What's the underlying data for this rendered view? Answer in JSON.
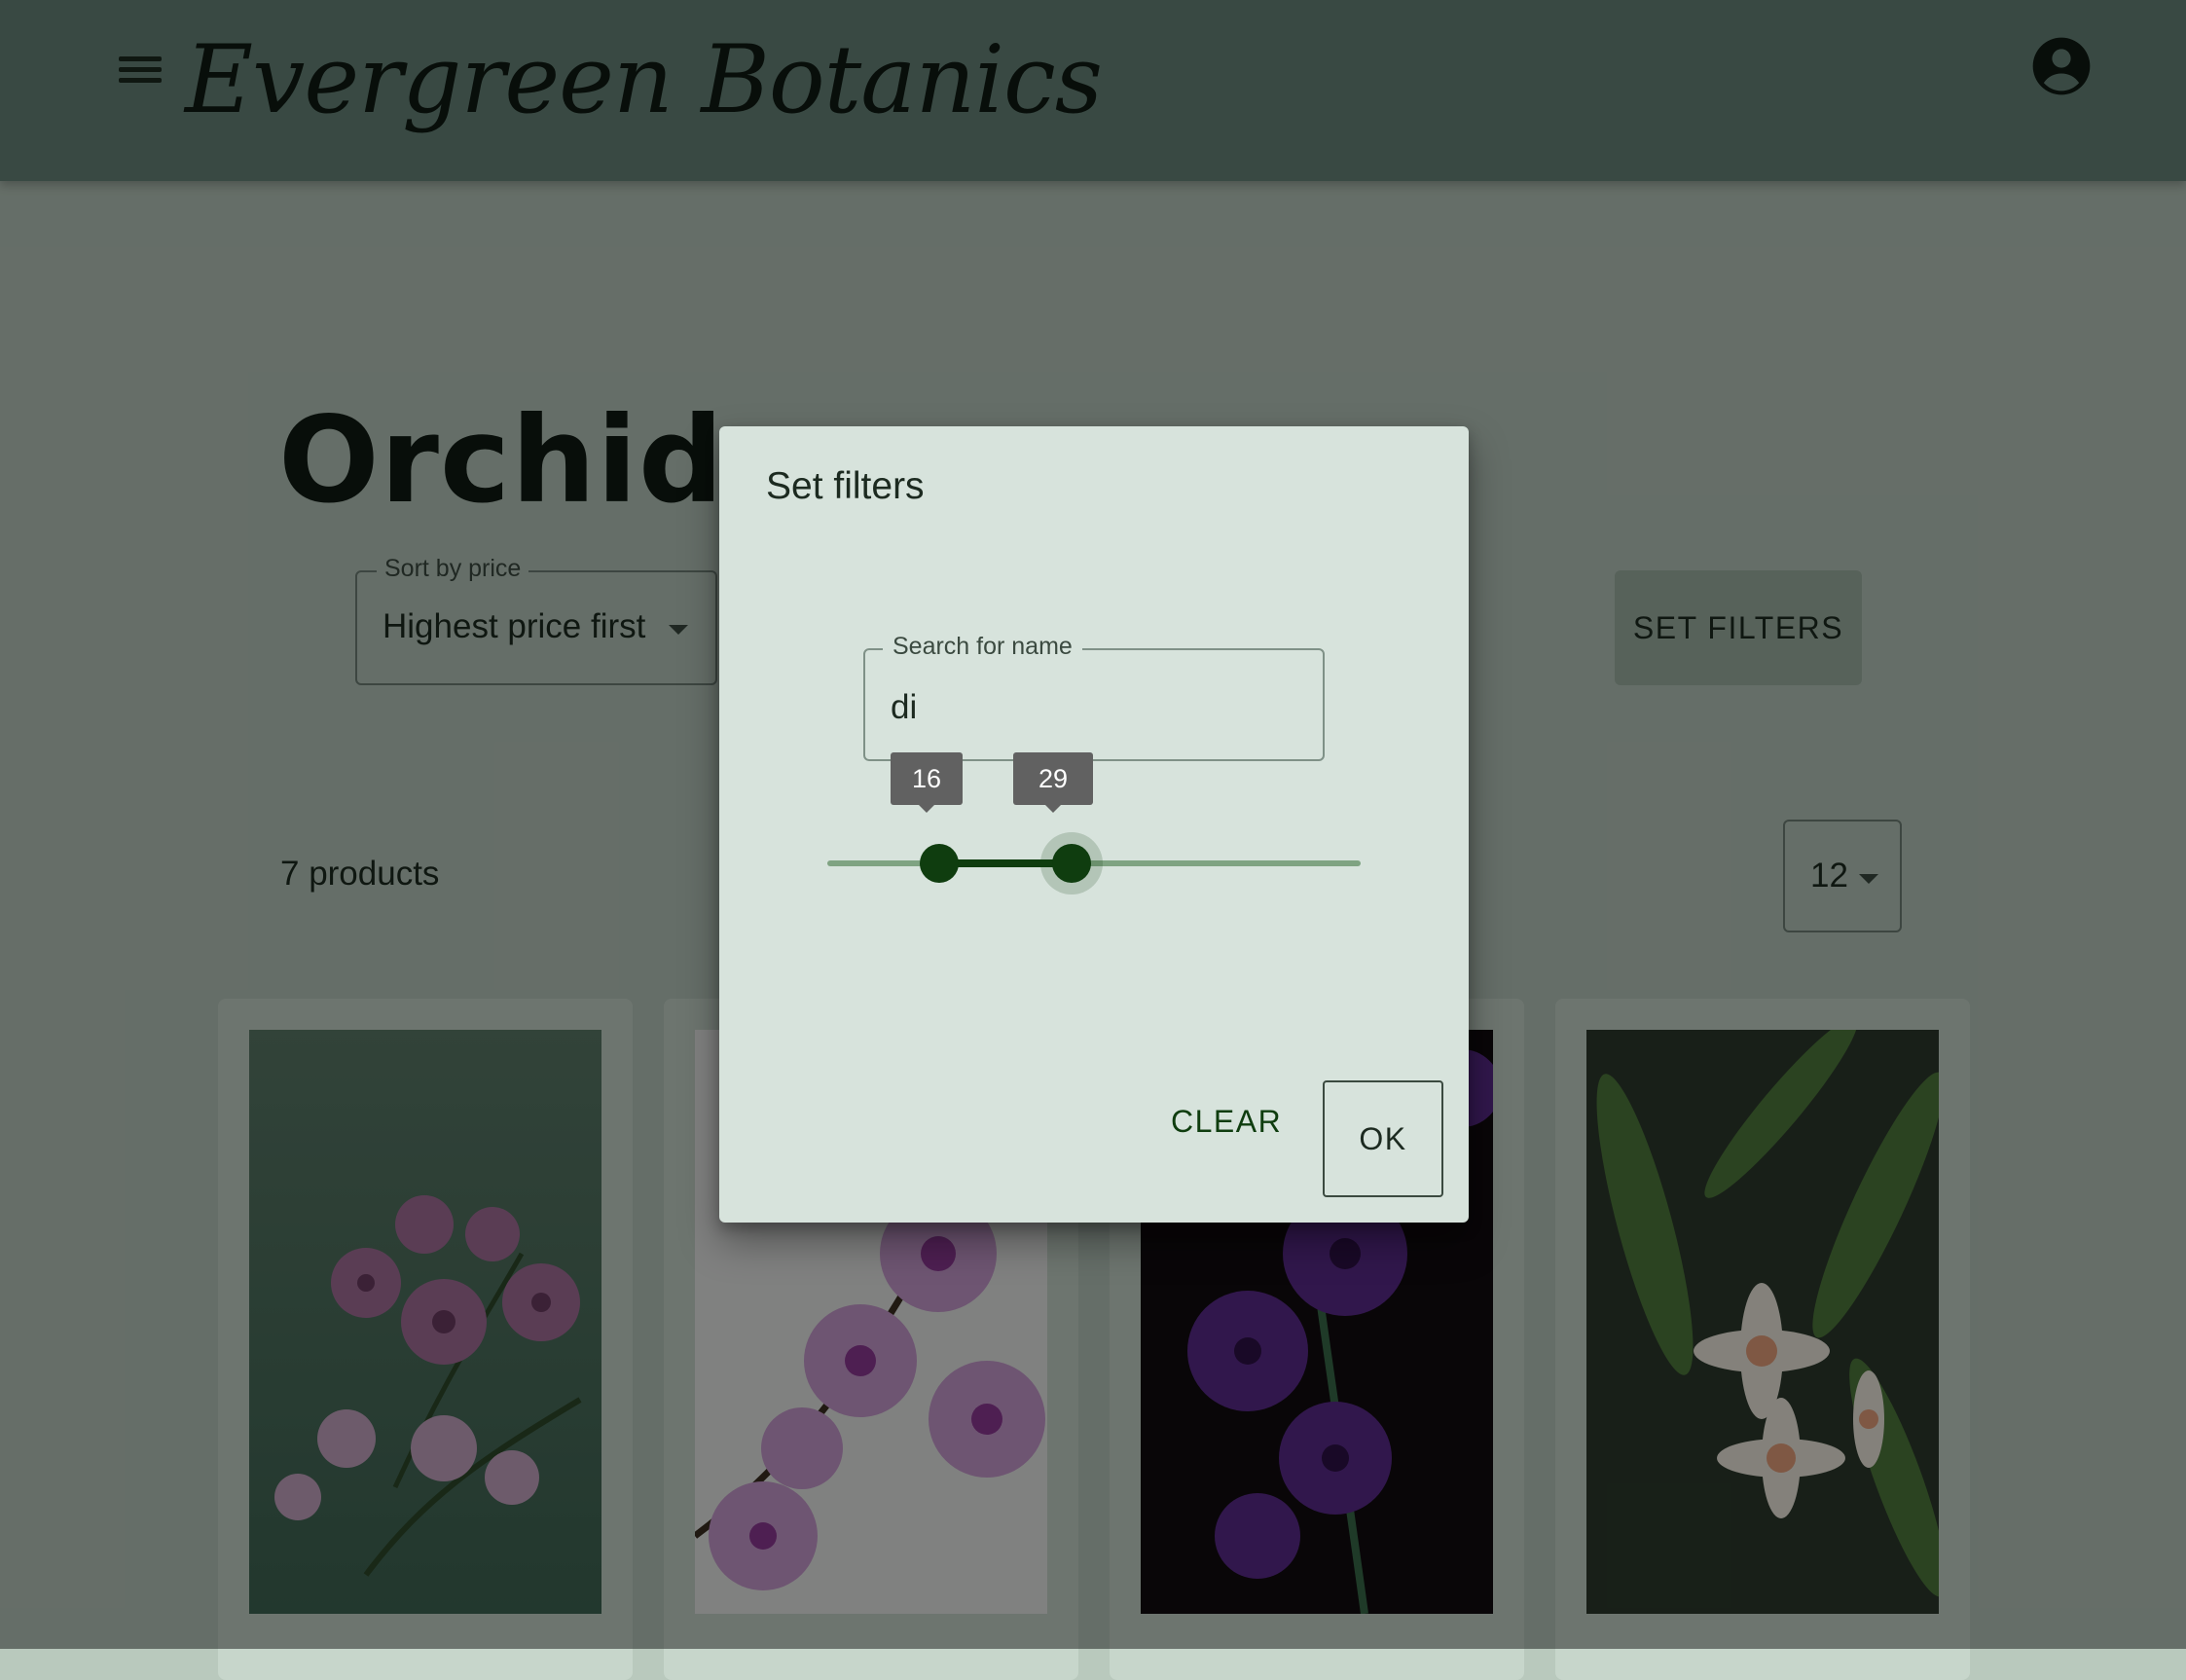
{
  "header": {
    "brand": "Evergreen Botanics",
    "menu_icon": "menu-icon",
    "account_icon": "account-circle-icon"
  },
  "page": {
    "title": "Orchids",
    "sort_label": "Sort by price",
    "sort_value": "Highest price first",
    "set_filters_label": "SET FILTERS",
    "product_count": "7 products",
    "per_page_value": "12"
  },
  "dialog": {
    "title": "Set filters",
    "search_label": "Search for name",
    "search_value": "di",
    "slider_low": "16",
    "slider_high": "29",
    "clear_label": "CLEAR",
    "ok_label": "OK"
  },
  "colors": {
    "appbar": "#68867a",
    "accent": "#0f3d0f",
    "dialog_bg": "#d7e3dc",
    "page_bg": "#b9c9bd"
  }
}
